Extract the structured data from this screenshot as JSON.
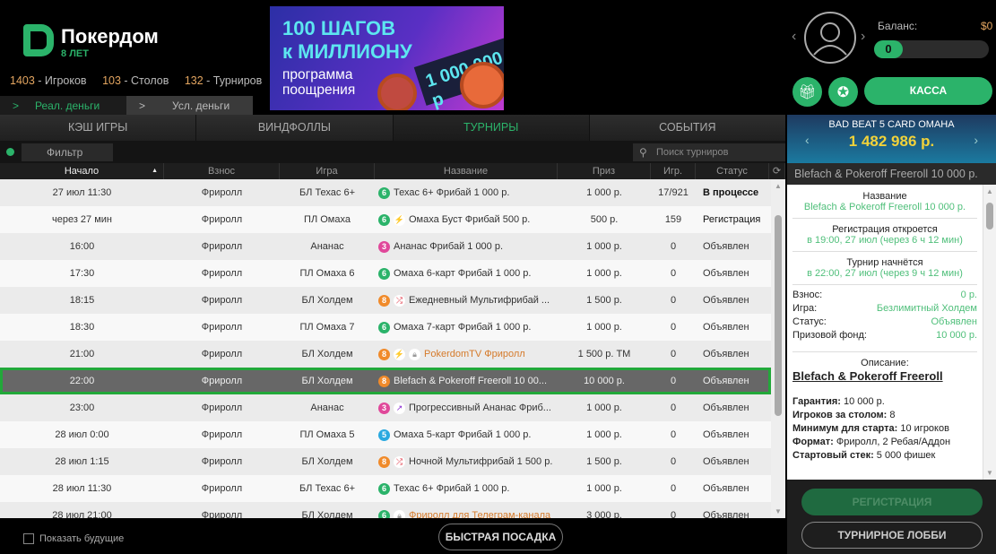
{
  "brand": {
    "name": "Покердом",
    "years_label": "ЛЕТ",
    "years": "8"
  },
  "stats": [
    {
      "n": "1403",
      "label": " - Игроков"
    },
    {
      "n": "103",
      "label": " - Столов"
    },
    {
      "n": "132",
      "label": " - Турниров"
    }
  ],
  "money_tabs": [
    {
      "label": "Реал. деньги",
      "active": true
    },
    {
      "label": "Усл. деньги",
      "active": false
    }
  ],
  "banner": {
    "line1": "100 ШАГОВ",
    "line2": "к МИЛЛИОНУ",
    "line3": "программа",
    "line4": "поощрения",
    "plate": "1 000 000 р"
  },
  "account": {
    "balance_label": "Баланс:",
    "balance": "$0",
    "level": "0",
    "cashier": "КАССА",
    "icons": [
      "gift-icon",
      "award-icon"
    ]
  },
  "tabs": [
    {
      "label": "КЭШ ИГРЫ"
    },
    {
      "label": "ВИНДФОЛЛЫ"
    },
    {
      "label": "ТУРНИРЫ",
      "active": true
    },
    {
      "label": "СОБЫТИЯ"
    }
  ],
  "filter": {
    "label": "Фильтр",
    "search_placeholder": "Поиск турниров"
  },
  "columns": [
    "Начало",
    "Взнос",
    "Игра",
    "Название",
    "Приз",
    "Игр.",
    "Статус"
  ],
  "rows": [
    {
      "start": "27 июл 11:30",
      "buyin": "Фриролл",
      "game": "БЛ Техас 6+",
      "seats": "6",
      "icons": [],
      "name": "Техас 6+ Фрибай 1 000 р.",
      "prize": "1 000 р.",
      "players": "17/921",
      "status": "В процессе"
    },
    {
      "start": "через 27 мин",
      "buyin": "Фриролл",
      "game": "ПЛ Омаха",
      "seats": "6",
      "icons": [
        "lightning"
      ],
      "name": "Омаха Буст Фрибай 500 р.",
      "prize": "500 р.",
      "players": "159",
      "status": "Регистрация"
    },
    {
      "start": "16:00",
      "buyin": "Фриролл",
      "game": "Ананас",
      "seats": "3",
      "icons": [],
      "name": "Ананас Фрибай 1 000 р.",
      "prize": "1 000 р.",
      "players": "0",
      "status": "Объявлен"
    },
    {
      "start": "17:30",
      "buyin": "Фриролл",
      "game": "ПЛ Омаха 6",
      "seats": "6",
      "icons": [],
      "name": "Омаха 6-карт Фрибай 1 000 р.",
      "prize": "1 000 р.",
      "players": "0",
      "status": "Объявлен"
    },
    {
      "start": "18:15",
      "buyin": "Фриролл",
      "game": "БЛ Холдем",
      "seats": "8",
      "icons": [
        "shuffle"
      ],
      "name": "Ежедневный Мультифрибай ...",
      "prize": "1 500 р.",
      "players": "0",
      "status": "Объявлен"
    },
    {
      "start": "18:30",
      "buyin": "Фриролл",
      "game": "ПЛ Омаха 7",
      "seats": "6",
      "icons": [],
      "name": "Омаха 7-карт Фрибай 1 000 р.",
      "prize": "1 000 р.",
      "players": "0",
      "status": "Объявлен"
    },
    {
      "start": "21:00",
      "buyin": "Фриролл",
      "game": "БЛ Холдем",
      "seats": "8",
      "icons": [
        "lightning",
        "lock"
      ],
      "name": "PokerdomTV Фриролл",
      "prize": "1 500 р. TM",
      "players": "0",
      "status": "Объявлен",
      "private": true
    },
    {
      "start": "22:00",
      "buyin": "Фриролл",
      "game": "БЛ Холдем",
      "seats": "8",
      "icons": [],
      "name": "Blefach & Pokeroff Freeroll 10 00...",
      "prize": "10 000 р.",
      "players": "0",
      "status": "Объявлен",
      "selected": true
    },
    {
      "start": "23:00",
      "buyin": "Фриролл",
      "game": "Ананас",
      "seats": "3",
      "icons": [
        "progressive"
      ],
      "name": "Прогрессивный Ананас Фриб...",
      "prize": "1 000 р.",
      "players": "0",
      "status": "Объявлен"
    },
    {
      "start": "28 июл 0:00",
      "buyin": "Фриролл",
      "game": "ПЛ Омаха 5",
      "seats": "5",
      "icons": [],
      "name": "Омаха 5-карт Фрибай 1 000 р.",
      "prize": "1 000 р.",
      "players": "0",
      "status": "Объявлен"
    },
    {
      "start": "28 июл 1:15",
      "buyin": "Фриролл",
      "game": "БЛ Холдем",
      "seats": "8",
      "icons": [
        "shuffle"
      ],
      "name": "Ночной Мультифрибай 1 500 р.",
      "prize": "1 500 р.",
      "players": "0",
      "status": "Объявлен"
    },
    {
      "start": "28 июл 11:30",
      "buyin": "Фриролл",
      "game": "БЛ Техас 6+",
      "seats": "6",
      "icons": [],
      "name": "Техас 6+ Фрибай 1 000 р.",
      "prize": "1 000 р.",
      "players": "0",
      "status": "Объявлен"
    },
    {
      "start": "28 июл 21:00",
      "buyin": "Фриролл",
      "game": "БЛ Холдем",
      "seats": "6",
      "icons": [
        "lock"
      ],
      "name": "Фриролл для Телеграм-канала",
      "prize": "3 000 р.",
      "players": "0",
      "status": "Объявлен",
      "private": true
    }
  ],
  "seat_colors": {
    "3": "#e0489a",
    "5": "#2aa9e0",
    "6": "#2bb36a",
    "8": "#f08a2a"
  },
  "bottom": {
    "show_future": "Показать будущие",
    "quick_seat": "БЫСТРАЯ ПОСАДКА"
  },
  "jackpot": {
    "title": "BAD BEAT 5 CARD OMAHA",
    "amount": "1 482 986 р."
  },
  "details": {
    "title": "Blefach & Pokeroff Freeroll 10 000 р.",
    "sections": [
      {
        "h": "Название",
        "v": "Blefach & Pokeroff Freeroll 10 000 р."
      },
      {
        "h": "Регистрация откроется",
        "v": "в 19:00, 27 июл (через 6 ч 12 мин)"
      },
      {
        "h": "Турнир начнётся",
        "v": "в 22:00, 27 июл (через 9 ч 12 мин)"
      }
    ],
    "kv": [
      {
        "k": "Взнос:",
        "v": "0 р."
      },
      {
        "k": "Игра:",
        "v": "Безлимитный Холдем"
      },
      {
        "k": "Статус:",
        "v": "Объявлен"
      },
      {
        "k": "Призовой фонд:",
        "v": "10 000 р."
      }
    ],
    "desc_label": "Описание:",
    "desc_title": "Blefach & Pokeroff Freeroll",
    "desc_lines": [
      {
        "k": "Гарантия:",
        "v": " 10 000 р."
      },
      {
        "k": "Игроков за столом:",
        "v": " 8"
      },
      {
        "k": "Минимум для старта:",
        "v": " 10 игроков"
      },
      {
        "k": "Формат:",
        "v": " Фриролл, 2 Ребая/Аддон"
      },
      {
        "k": "Стартовый стек:",
        "v": " 5 000 фишек"
      }
    ],
    "register": "РЕГИСТРАЦИЯ",
    "lobby": "ТУРНИРНОЕ ЛОББИ"
  }
}
